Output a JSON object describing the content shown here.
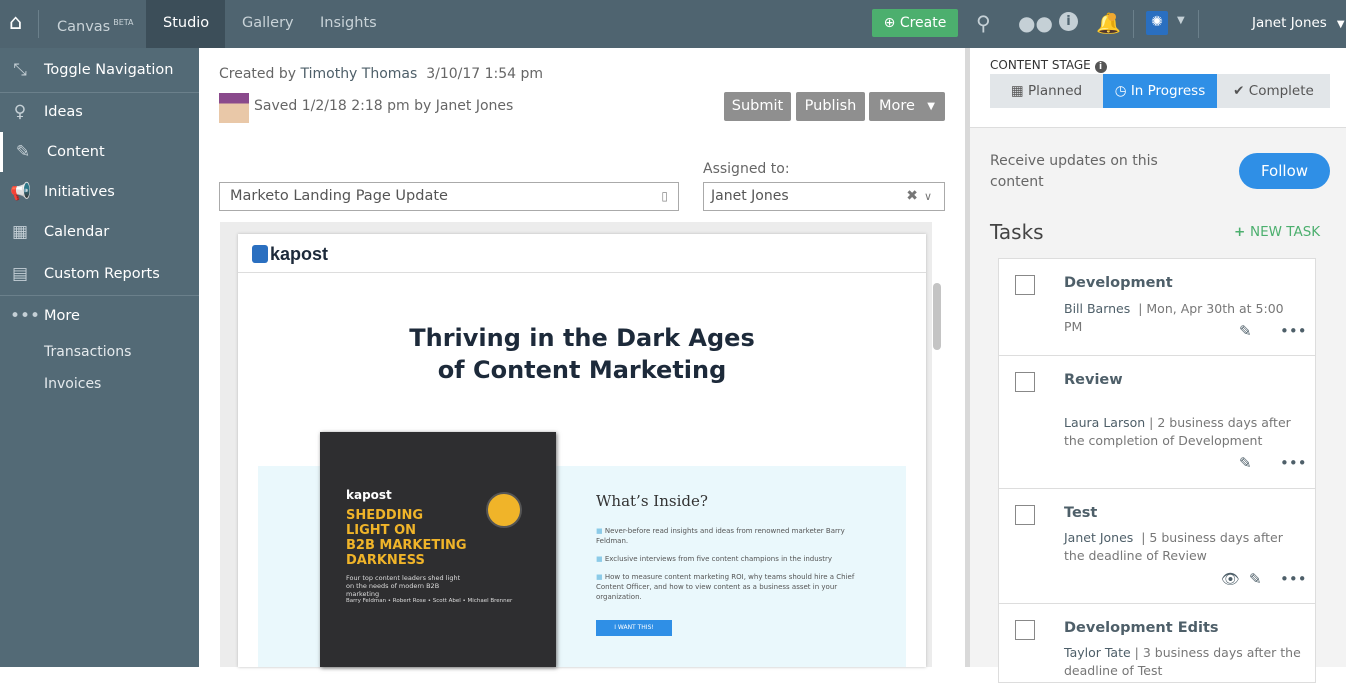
{
  "topnav": {
    "home_icon": "home-icon",
    "canvas": "Canvas",
    "beta": "BETA",
    "tabs": [
      "Studio",
      "Gallery",
      "Insights"
    ],
    "create": "Create",
    "user": "Janet Jones",
    "notification_color": "#f0a830"
  },
  "sidebar": {
    "items": [
      {
        "label": "Toggle Navigation",
        "icon": "compress-icon"
      },
      {
        "label": "Ideas",
        "icon": "lightbulb-icon"
      },
      {
        "label": "Content",
        "icon": "pencil-icon"
      },
      {
        "label": "Initiatives",
        "icon": "megaphone-icon"
      },
      {
        "label": "Calendar",
        "icon": "calendar-icon"
      },
      {
        "label": "Custom Reports",
        "icon": "file-icon"
      },
      {
        "label": "More",
        "icon": "ellipsis-icon"
      }
    ],
    "subitems": [
      "Transactions",
      "Invoices"
    ]
  },
  "main": {
    "created_label": "Created by",
    "created_by": "Timothy Thomas",
    "created_at": "3/10/17 1:54 pm",
    "saved": "Saved 1/2/18 2:18 pm by",
    "saved_by": "Janet Jones",
    "buttons": {
      "submit": "Submit",
      "publish": "Publish",
      "more": "More"
    },
    "title_value": "Marketo Landing Page Update",
    "assigned_label": "Assigned to:",
    "assigned_value": "Janet Jones"
  },
  "preview": {
    "logo": "kapost",
    "headline1": "Thriving in the Dark Ages",
    "headline2": "of Content Marketing",
    "book": {
      "logo": "kapost",
      "title": [
        "SHEDDING",
        "LIGHT ON",
        "B2B MARKETING",
        "DARKNESS"
      ],
      "subtitle": "Four top content leaders shed light on the needs of modern B2B marketing",
      "authors": "Barry Feldman • Robert Rose • Scott Abel • Michael Brenner"
    },
    "inside_title": "What’s Inside?",
    "bullets": [
      "Never-before read insights and ideas from renowned marketer Barry Feldman.",
      "Exclusive interviews from five content champions in the industry",
      "How to measure content marketing ROI, why teams should hire a Chief Content Officer, and how to view content as a business asset in your organization."
    ],
    "cta": "I WANT THIS!"
  },
  "right": {
    "stage_label": "CONTENT STAGE",
    "stages": [
      "Planned",
      "In Progress",
      "Complete"
    ],
    "active_stage": "In Progress",
    "accent": "#2f8fe6",
    "follow_text": "Receive updates on this content",
    "follow": "Follow",
    "tasks_title": "Tasks",
    "new_task": "NEW TASK",
    "tasks": [
      {
        "title": "Development",
        "assignee": "Bill Barnes",
        "due": "| Mon, Apr 30th at 5:00 PM"
      },
      {
        "title": "Review",
        "assignee": "Laura Larson",
        "due": "| 2 business days after the completion of Development"
      },
      {
        "title": "Test",
        "assignee": "Janet Jones",
        "due": "| 5 business days after the deadline of Review"
      },
      {
        "title": "Development Edits",
        "assignee": "Taylor Tate",
        "due": "| 3 business days after the deadline of Test"
      }
    ]
  }
}
